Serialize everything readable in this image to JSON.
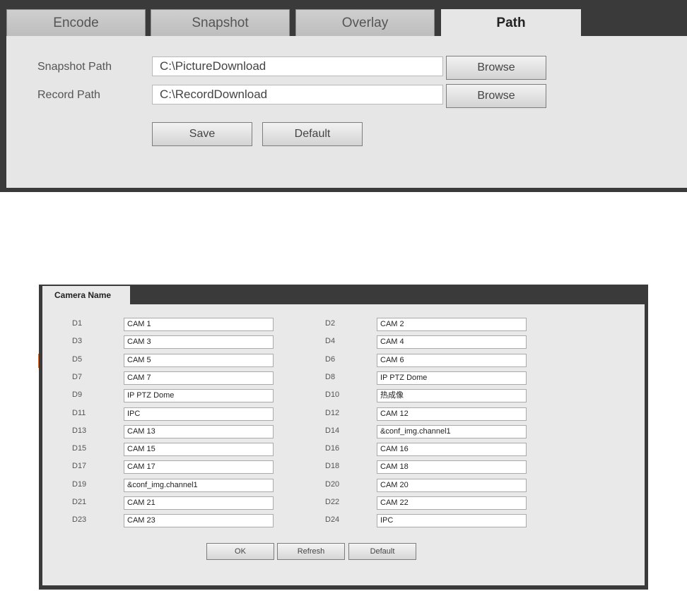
{
  "path_panel": {
    "tabs": [
      {
        "label": "Encode",
        "active": false
      },
      {
        "label": "Snapshot",
        "active": false
      },
      {
        "label": "Overlay",
        "active": false
      },
      {
        "label": "Path",
        "active": true
      }
    ],
    "snapshot_path": {
      "label": "Snapshot Path",
      "value": "C:\\PictureDownload",
      "browse_label": "Browse"
    },
    "record_path": {
      "label": "Record Path",
      "value": "C:\\RecordDownload",
      "browse_label": "Browse"
    },
    "save_label": "Save",
    "default_label": "Default"
  },
  "camera_panel": {
    "tab_label": "Camera Name",
    "left_column": [
      {
        "id": "D1",
        "name": "CAM 1"
      },
      {
        "id": "D3",
        "name": "CAM 3"
      },
      {
        "id": "D5",
        "name": "CAM 5"
      },
      {
        "id": "D7",
        "name": "CAM 7"
      },
      {
        "id": "D9",
        "name": "IP PTZ Dome"
      },
      {
        "id": "D11",
        "name": "IPC"
      },
      {
        "id": "D13",
        "name": "CAM 13"
      },
      {
        "id": "D15",
        "name": "CAM 15"
      },
      {
        "id": "D17",
        "name": "CAM 17"
      },
      {
        "id": "D19",
        "name": "&conf_img.channel1"
      },
      {
        "id": "D21",
        "name": "CAM 21"
      },
      {
        "id": "D23",
        "name": "CAM 23"
      }
    ],
    "right_column": [
      {
        "id": "D2",
        "name": "CAM 2"
      },
      {
        "id": "D4",
        "name": "CAM 4"
      },
      {
        "id": "D6",
        "name": "CAM 6"
      },
      {
        "id": "D8",
        "name": "IP PTZ Dome"
      },
      {
        "id": "D10",
        "name": "热成像"
      },
      {
        "id": "D12",
        "name": "CAM 12"
      },
      {
        "id": "D14",
        "name": "&conf_img.channel1"
      },
      {
        "id": "D16",
        "name": "CAM 16"
      },
      {
        "id": "D18",
        "name": "CAM 18"
      },
      {
        "id": "D20",
        "name": "CAM 20"
      },
      {
        "id": "D22",
        "name": "CAM 22"
      },
      {
        "id": "D24",
        "name": "IPC"
      }
    ],
    "ok_label": "OK",
    "refresh_label": "Refresh",
    "default_label": "Default"
  }
}
